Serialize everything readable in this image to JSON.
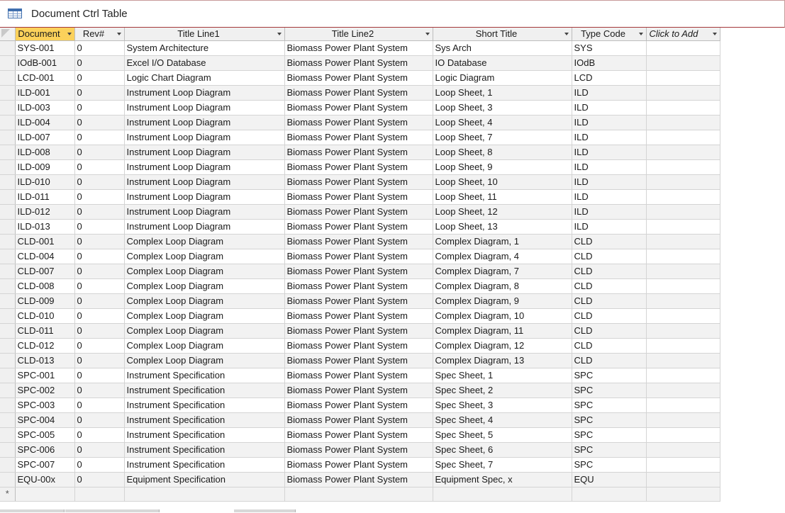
{
  "window": {
    "title": "Document Ctrl Table",
    "icon": "table-icon"
  },
  "columns": [
    {
      "label": "Document"
    },
    {
      "label": "Rev#"
    },
    {
      "label": "Title Line1"
    },
    {
      "label": "Title Line2"
    },
    {
      "label": "Short Title"
    },
    {
      "label": "Type Code"
    },
    {
      "label": "Click to Add"
    }
  ],
  "rows": [
    [
      "SYS-001",
      "0",
      "System Architecture",
      "Biomass Power Plant System",
      "Sys Arch",
      "SYS",
      ""
    ],
    [
      "IOdB-001",
      "0",
      "Excel I/O Database",
      "Biomass Power Plant System",
      "IO Database",
      "IOdB",
      ""
    ],
    [
      "LCD-001",
      "0",
      "Logic Chart Diagram",
      "Biomass Power Plant System",
      "Logic Diagram",
      "LCD",
      ""
    ],
    [
      "ILD-001",
      "0",
      "Instrument Loop Diagram",
      "Biomass Power Plant System",
      "Loop Sheet, 1",
      "ILD",
      ""
    ],
    [
      "ILD-003",
      "0",
      "Instrument Loop Diagram",
      "Biomass Power Plant System",
      "Loop Sheet, 3",
      "ILD",
      ""
    ],
    [
      "ILD-004",
      "0",
      "Instrument Loop Diagram",
      "Biomass Power Plant System",
      "Loop Sheet, 4",
      "ILD",
      ""
    ],
    [
      "ILD-007",
      "0",
      "Instrument Loop Diagram",
      "Biomass Power Plant System",
      "Loop Sheet, 7",
      "ILD",
      ""
    ],
    [
      "ILD-008",
      "0",
      "Instrument Loop Diagram",
      "Biomass Power Plant System",
      "Loop Sheet, 8",
      "ILD",
      ""
    ],
    [
      "ILD-009",
      "0",
      "Instrument Loop Diagram",
      "Biomass Power Plant System",
      "Loop Sheet, 9",
      "ILD",
      ""
    ],
    [
      "ILD-010",
      "0",
      "Instrument Loop Diagram",
      "Biomass Power Plant System",
      "Loop Sheet, 10",
      "ILD",
      ""
    ],
    [
      "ILD-011",
      "0",
      "Instrument Loop Diagram",
      "Biomass Power Plant System",
      "Loop Sheet, 11",
      "ILD",
      ""
    ],
    [
      "ILD-012",
      "0",
      "Instrument Loop Diagram",
      "Biomass Power Plant System",
      "Loop Sheet, 12",
      "ILD",
      ""
    ],
    [
      "ILD-013",
      "0",
      "Instrument Loop Diagram",
      "Biomass Power Plant System",
      "Loop Sheet, 13",
      "ILD",
      ""
    ],
    [
      "CLD-001",
      "0",
      "Complex Loop Diagram",
      "Biomass Power Plant System",
      "Complex Diagram, 1",
      "CLD",
      ""
    ],
    [
      "CLD-004",
      "0",
      "Complex Loop Diagram",
      "Biomass Power Plant System",
      "Complex Diagram, 4",
      "CLD",
      ""
    ],
    [
      "CLD-007",
      "0",
      "Complex Loop Diagram",
      "Biomass Power Plant System",
      "Complex Diagram, 7",
      "CLD",
      ""
    ],
    [
      "CLD-008",
      "0",
      "Complex Loop Diagram",
      "Biomass Power Plant System",
      "Complex Diagram, 8",
      "CLD",
      ""
    ],
    [
      "CLD-009",
      "0",
      "Complex Loop Diagram",
      "Biomass Power Plant System",
      "Complex Diagram, 9",
      "CLD",
      ""
    ],
    [
      "CLD-010",
      "0",
      "Complex Loop Diagram",
      "Biomass Power Plant System",
      "Complex Diagram, 10",
      "CLD",
      ""
    ],
    [
      "CLD-011",
      "0",
      "Complex Loop Diagram",
      "Biomass Power Plant System",
      "Complex Diagram, 11",
      "CLD",
      ""
    ],
    [
      "CLD-012",
      "0",
      "Complex Loop Diagram",
      "Biomass Power Plant System",
      "Complex Diagram, 12",
      "CLD",
      ""
    ],
    [
      "CLD-013",
      "0",
      "Complex Loop Diagram",
      "Biomass Power Plant System",
      "Complex Diagram, 13",
      "CLD",
      ""
    ],
    [
      "SPC-001",
      "0",
      "Instrument Specification",
      "Biomass Power Plant System",
      "Spec Sheet, 1",
      "SPC",
      ""
    ],
    [
      "SPC-002",
      "0",
      "Instrument Specification",
      "Biomass Power Plant System",
      "Spec Sheet, 2",
      "SPC",
      ""
    ],
    [
      "SPC-003",
      "0",
      "Instrument Specification",
      "Biomass Power Plant System",
      "Spec Sheet, 3",
      "SPC",
      ""
    ],
    [
      "SPC-004",
      "0",
      "Instrument Specification",
      "Biomass Power Plant System",
      "Spec Sheet, 4",
      "SPC",
      ""
    ],
    [
      "SPC-005",
      "0",
      "Instrument Specification",
      "Biomass Power Plant System",
      "Spec Sheet, 5",
      "SPC",
      ""
    ],
    [
      "SPC-006",
      "0",
      "Instrument Specification",
      "Biomass Power Plant System",
      "Spec Sheet, 6",
      "SPC",
      ""
    ],
    [
      "SPC-007",
      "0",
      "Instrument Specification",
      "Biomass Power Plant System",
      "Spec Sheet, 7",
      "SPC",
      ""
    ],
    [
      "EQU-00x",
      "0",
      "Equipment Specification",
      "Biomass Power Plant System",
      "Equipment Spec, x",
      "EQU",
      ""
    ]
  ],
  "new_record_marker": "*"
}
